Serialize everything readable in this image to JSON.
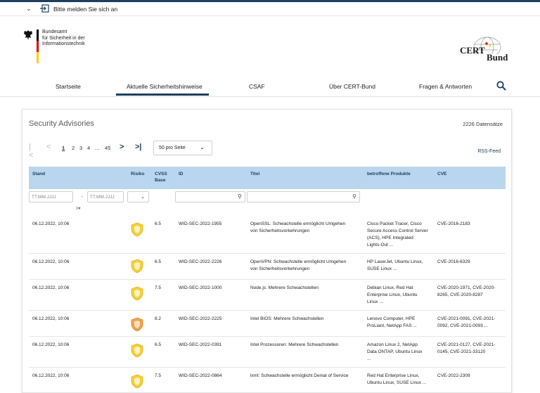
{
  "loginbar": {
    "chevron": "chevron-down-icon",
    "icon": "login-icon",
    "label": "Bitte melden Sie sich an"
  },
  "org": {
    "line1": "Bundesamt",
    "line2": "für Sicherheit in der",
    "line3": "Informationstechnik",
    "flag_colors": [
      "#000000",
      "#dd0000",
      "#ffce00"
    ]
  },
  "cert_logo": {
    "part1": "CERT",
    "part2": "Bund"
  },
  "nav": {
    "items": [
      "Startseite",
      "Aktuelle Sicherheitshinweise",
      "CSAF",
      "Über CERT-Bund",
      "Fragen & Antworten"
    ],
    "active": "Aktuelle Sicherheitshinweise",
    "accent": "#1c3f60"
  },
  "advisories": {
    "title": "Security Advisories",
    "count": "2226 Datensätze",
    "pager": {
      "first": "|<",
      "prev": "<",
      "pages": [
        "1",
        "2",
        "3",
        "4",
        "...",
        "45"
      ],
      "current": "1",
      "next": ">",
      "last": ">|"
    },
    "per_page": "50 pro Seite",
    "rss": "RSS-Feed",
    "columns": {
      "stand": "Stand",
      "risiko": "Risiko",
      "cvss1": "CVSS",
      "cvss2": "Base",
      "id": "ID",
      "titel": "Titel",
      "produkte": "betroffene Produkte",
      "cve": "CVE"
    },
    "filter_placeholders": {
      "date_from": "TT.MM.JJJJ",
      "date_to": "TT.MM.JJJJ"
    },
    "header_color": "#b9d6ee",
    "rows": [
      {
        "stand": "06.12.2022, 10:06",
        "risk_color": "#f5cf3a",
        "cvss": "6.5",
        "id": "WID-SEC-2022-1955",
        "titel": [
          "OpenSSL: Schwachstelle ermöglicht Umgehen",
          "von Sicherheitsvorkehrungen"
        ],
        "produkte": [
          "Cisco Packet Tracer, Cisco",
          "Secure Access Control Server",
          "(ACS), HPE Integrated",
          "Lights-Out ..."
        ],
        "cve": [
          "CVE-2016-2183"
        ]
      },
      {
        "stand": "06.12.2022, 10:06",
        "risk_color": "#f5cf3a",
        "cvss": "6.5",
        "id": "WID-SEC-2022-2226",
        "titel": [
          "OpenVPN: Schwachstelle ermöglicht Umgehen",
          "von Sicherheitsvorkehrungen"
        ],
        "produkte": [
          "HP LaserJet, Ubuntu Linux,",
          "SUSE Linux ..."
        ],
        "cve": [
          "CVE-2016-6329"
        ]
      },
      {
        "stand": "06.12.2022, 10:06",
        "risk_color": "#f5cf3a",
        "cvss": "7.5",
        "id": "WID-SEC-2022-1000",
        "titel": [
          "Node.js: Mehrere Schwachstellen"
        ],
        "produkte": [
          "Debian Linux, Red Hat",
          "Enterprise Linux, Ubuntu",
          "Linux ..."
        ],
        "cve": [
          "CVE-2020-1971, CVE-2020-",
          "8265, CVE-2020-8287"
        ]
      },
      {
        "stand": "06.12.2022, 10:06",
        "risk_color": "#f2a24c",
        "cvss": "8.2",
        "id": "WID-SEC-2022-2225",
        "titel": [
          "Intel BIOS: Mehrere Schwachstellen"
        ],
        "produkte": [
          "Lenovo Computer, HPE",
          "ProLiant, NetApp FAS ..."
        ],
        "cve": [
          "CVE-2021-0091, CVE-2021-",
          "0092, CVE-2021-0093 ..."
        ]
      },
      {
        "stand": "06.12.2022, 10:06",
        "risk_color": "#f5cf3a",
        "cvss": "6.5",
        "id": "WID-SEC-2022-0391",
        "titel": [
          "Intel Prozessoren: Mehrere Schwachstellen"
        ],
        "produkte": [
          "Amazon Linux 2, NetApp",
          "Data ONTAP, Ubuntu Linux",
          "..."
        ],
        "cve": [
          "CVE-2021-0127, CVE-2021-",
          "0145, CVE-2021-33120"
        ]
      },
      {
        "stand": "06.12.2022, 10:06",
        "risk_color": "#f5cf3a",
        "cvss": "7.5",
        "id": "WID-SEC-2022-0864",
        "titel": [
          "lxml: Schwachstelle ermöglicht Denial of Service"
        ],
        "produkte": [
          "Red Hat Enterprise Linux,",
          "Ubuntu Linux, SUSE Linux ..."
        ],
        "cve": [
          "CVE-2022-2309"
        ]
      }
    ]
  }
}
